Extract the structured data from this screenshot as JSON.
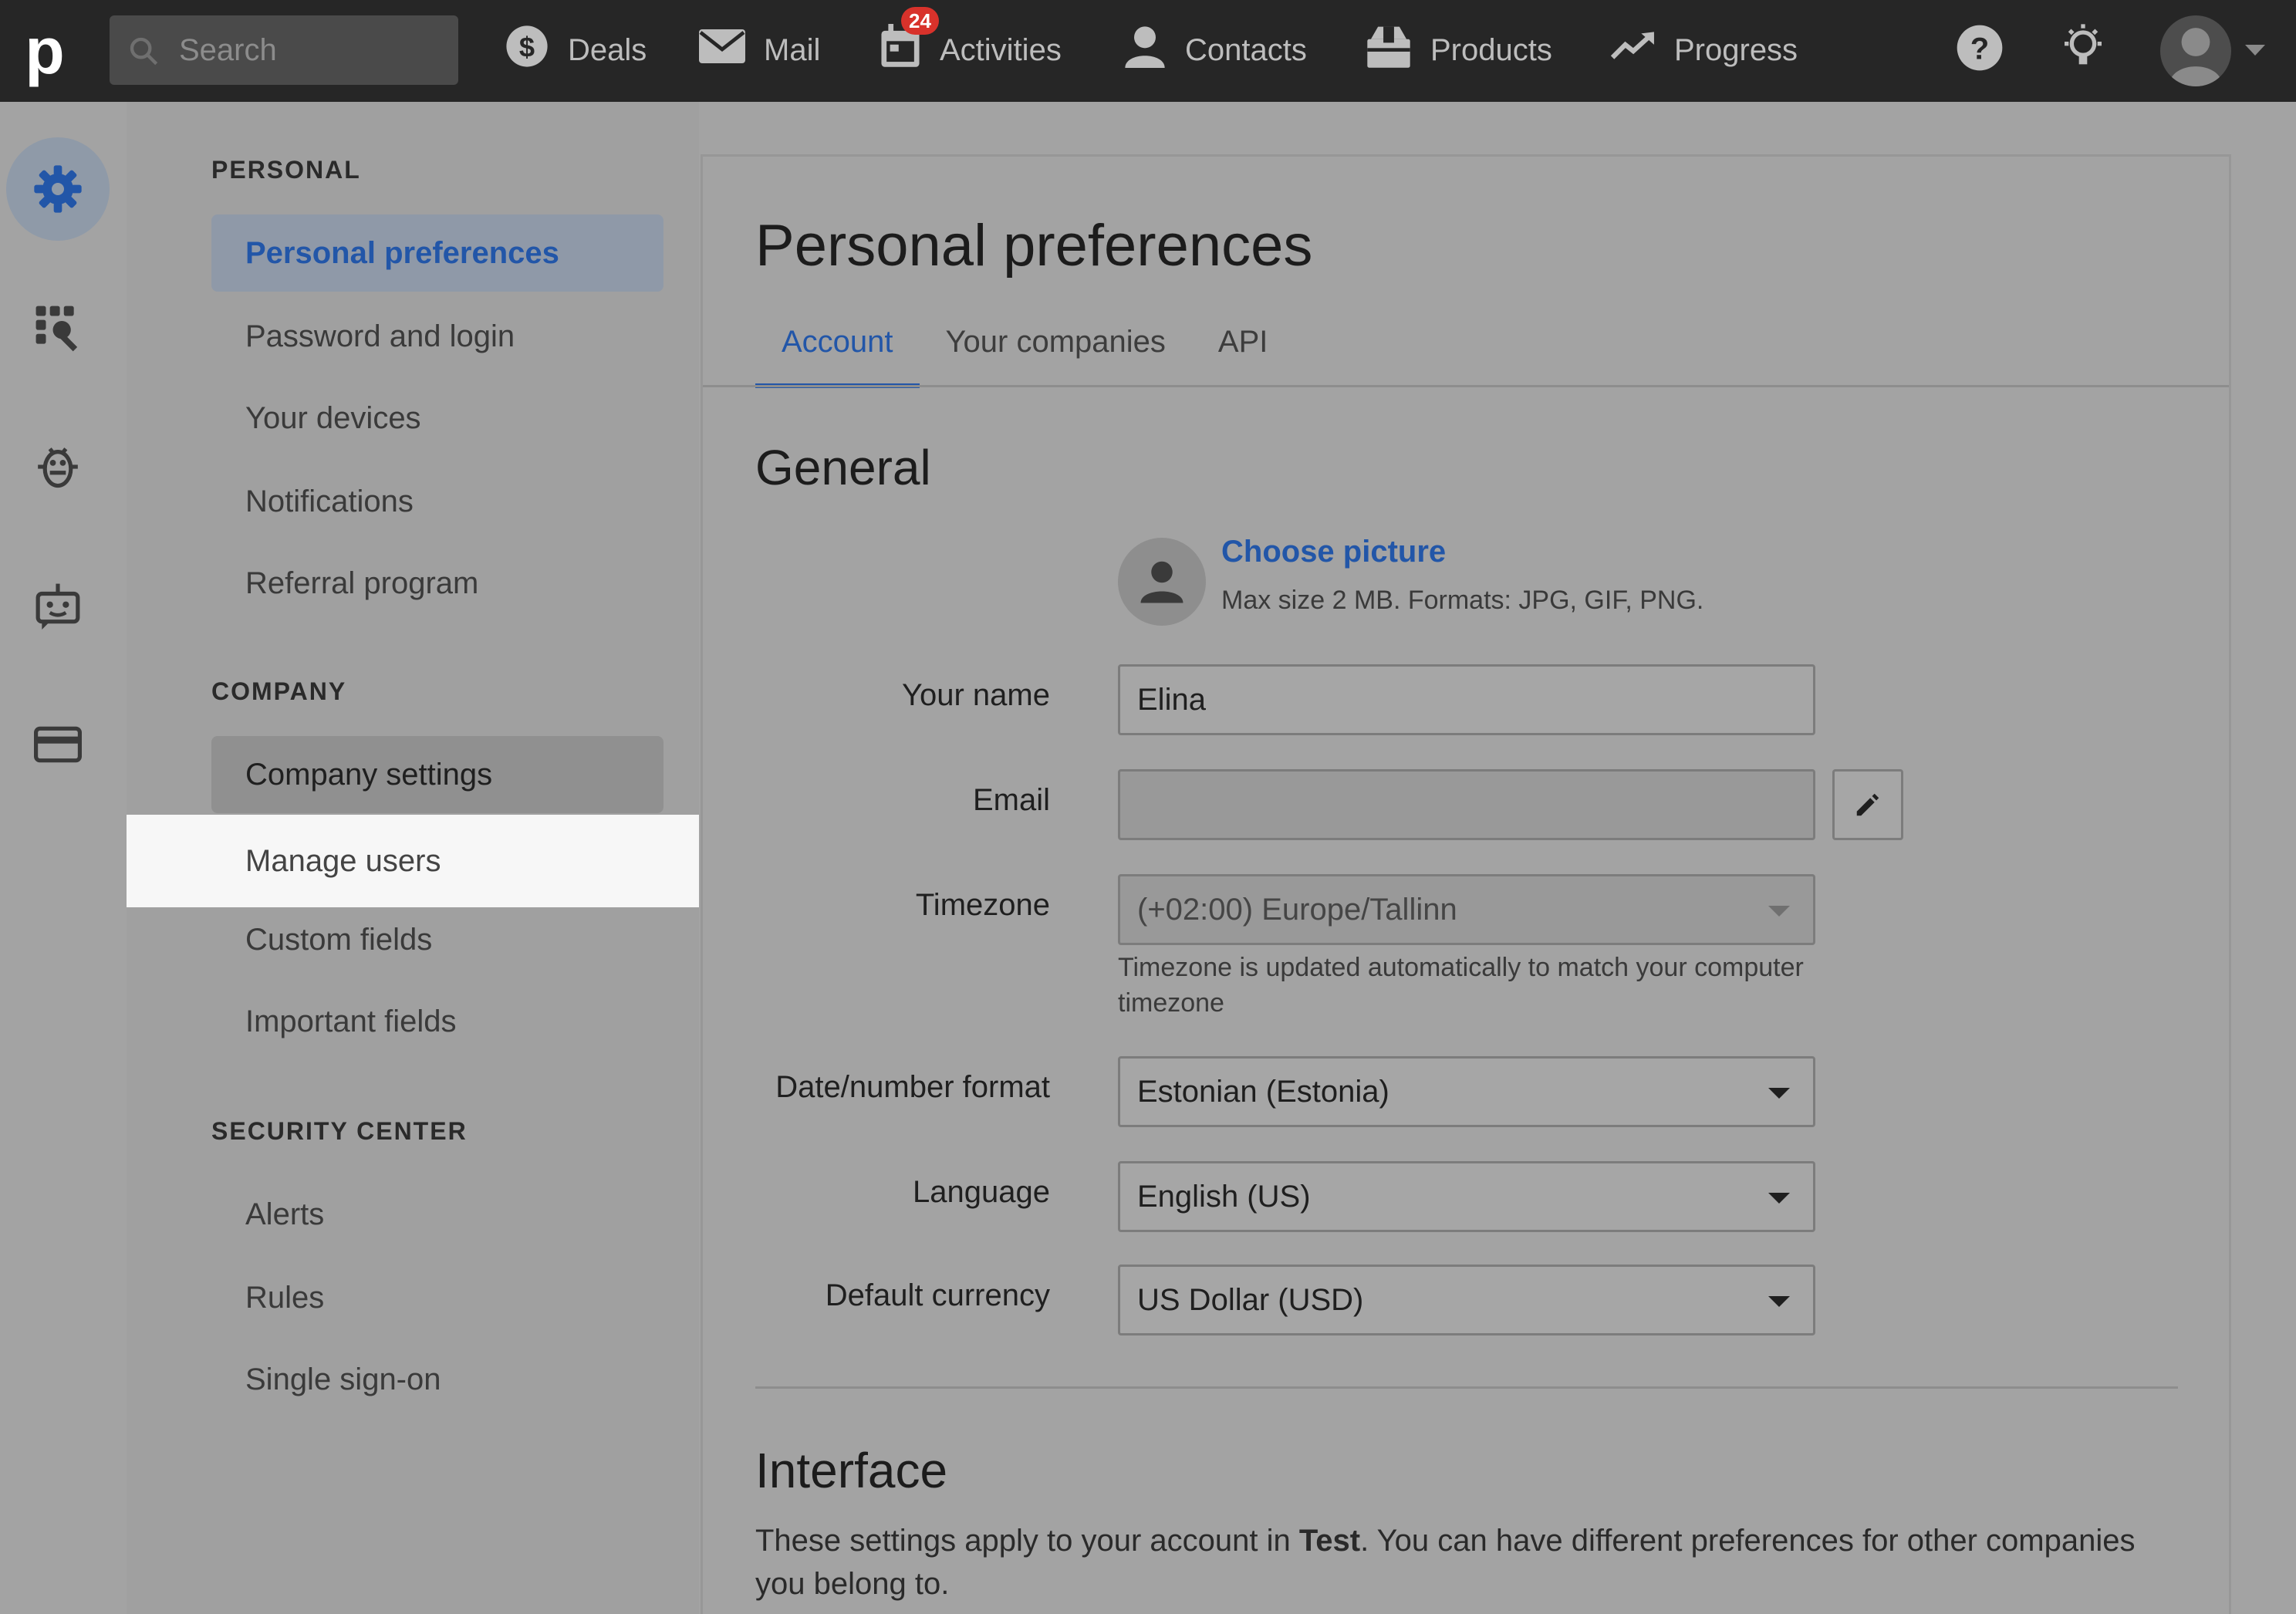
{
  "topbar": {
    "logo": "p",
    "search_placeholder": "Search",
    "nav": [
      {
        "label": "Deals",
        "icon": "dollar-icon"
      },
      {
        "label": "Mail",
        "icon": "mail-icon"
      },
      {
        "label": "Activities",
        "icon": "calendar-icon",
        "badge": "24"
      },
      {
        "label": "Contacts",
        "icon": "person-icon"
      },
      {
        "label": "Products",
        "icon": "box-icon"
      },
      {
        "label": "Progress",
        "icon": "trend-icon"
      }
    ]
  },
  "rail": [
    "gear-icon",
    "tools-icon",
    "bug-icon",
    "robot-icon",
    "card-icon"
  ],
  "settings_nav": {
    "personal_title": "PERSONAL",
    "personal": [
      "Personal preferences",
      "Password and login",
      "Your devices",
      "Notifications",
      "Referral program"
    ],
    "company_title": "COMPANY",
    "company": [
      "Company settings",
      "Manage users",
      "Custom fields",
      "Important fields"
    ],
    "security_title": "SECURITY CENTER",
    "security": [
      "Alerts",
      "Rules",
      "Single sign-on"
    ]
  },
  "main": {
    "title": "Personal preferences",
    "tabs": [
      "Account",
      "Your companies",
      "API"
    ],
    "general_title": "General",
    "choose_picture": "Choose picture",
    "picture_hint": "Max size 2 MB. Formats: JPG, GIF, PNG.",
    "fields": {
      "name_label": "Your name",
      "name_value": "Elina",
      "email_label": "Email",
      "email_value": "",
      "timezone_label": "Timezone",
      "timezone_value": "(+02:00) Europe/Tallinn",
      "timezone_help": "Timezone is updated automatically to match your computer timezone",
      "format_label": "Date/number format",
      "format_value": "Estonian (Estonia)",
      "language_label": "Language",
      "language_value": "English (US)",
      "currency_label": "Default currency",
      "currency_value": "US Dollar (USD)"
    },
    "interface_title": "Interface",
    "interface_text_before": "These settings apply to your account in ",
    "interface_company": "Test",
    "interface_text_after": ". You can have different preferences for other companies you belong to."
  }
}
